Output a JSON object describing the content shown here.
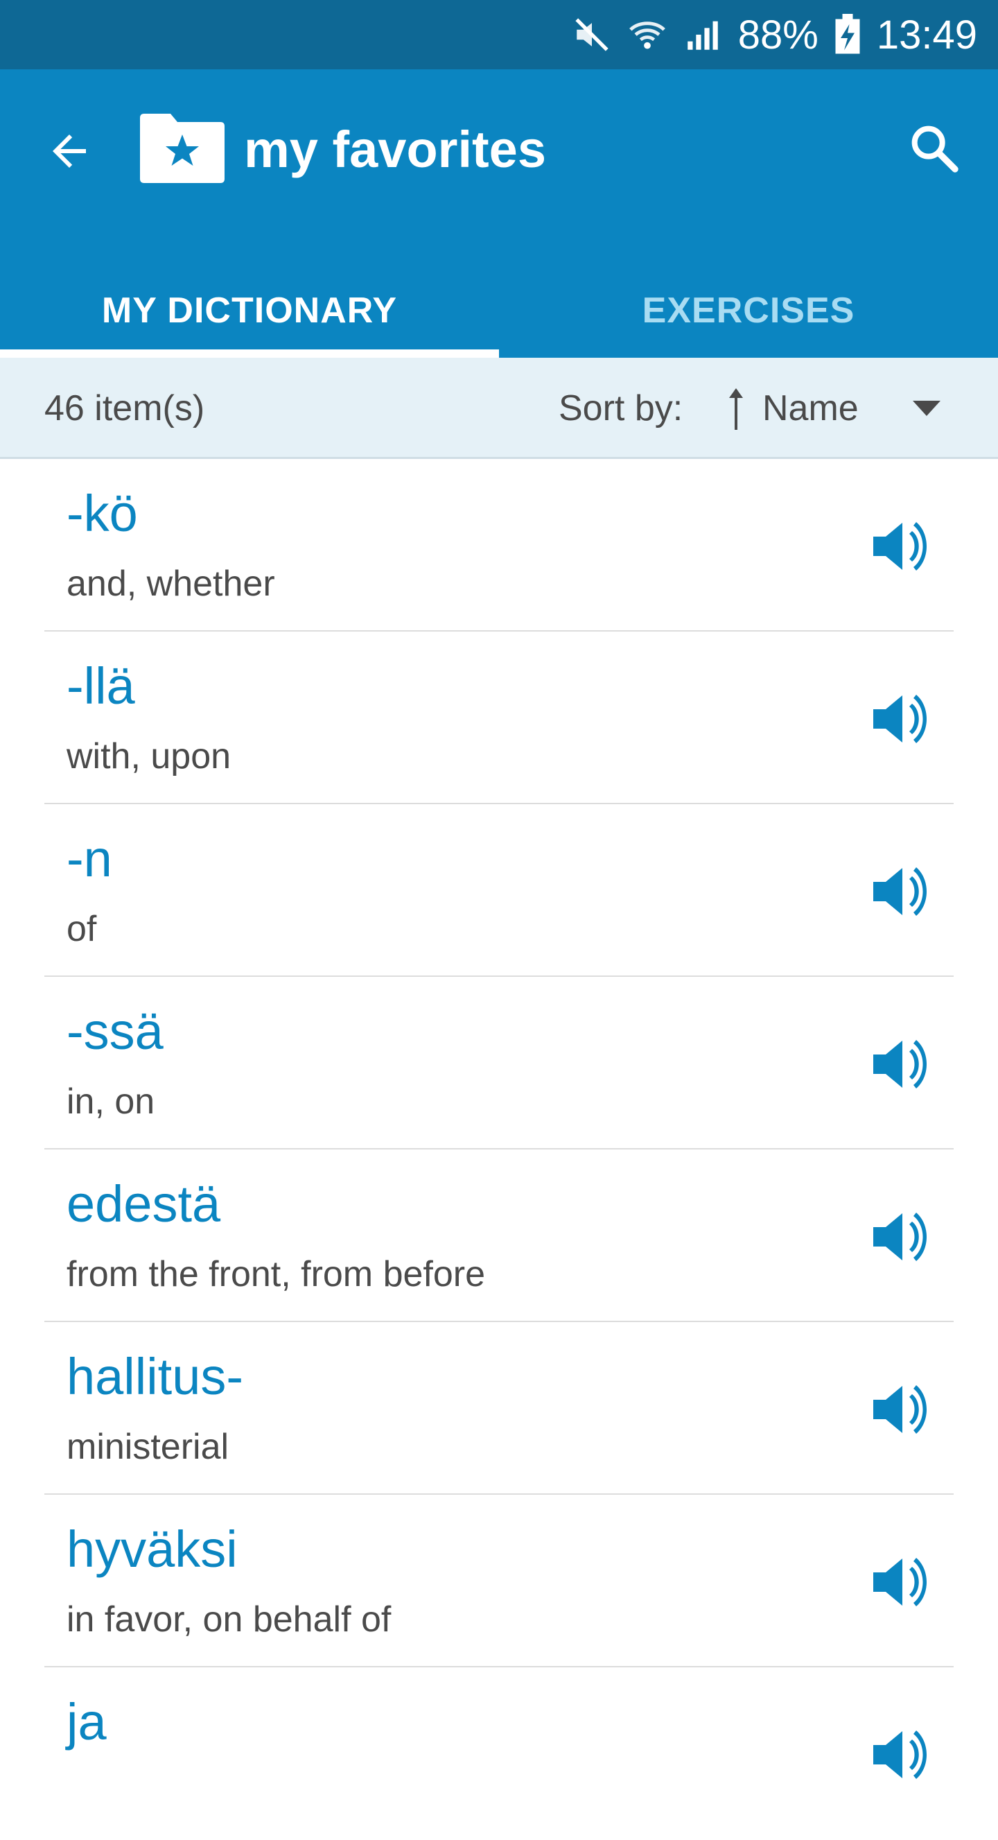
{
  "status_bar": {
    "battery_percent": "88%",
    "time": "13:49",
    "icons": [
      "mute-icon",
      "wifi-icon",
      "signal-icon",
      "battery-charging-icon"
    ]
  },
  "app_bar": {
    "title": "my favorites",
    "icons": [
      "back-arrow-icon",
      "folder-star-icon",
      "search-icon"
    ],
    "tabs": [
      {
        "label": "MY DICTIONARY",
        "selected": true
      },
      {
        "label": "EXERCISES",
        "selected": false
      }
    ]
  },
  "toolbar": {
    "item_count": "46 item(s)",
    "sort_label": "Sort by:",
    "sort_value": "Name",
    "sort_direction_icon": "sort-ascending-icon",
    "dropdown_icon": "dropdown-triangle-icon"
  },
  "items": [
    {
      "term": "-kö",
      "meaning": "and, whether"
    },
    {
      "term": "-llä",
      "meaning": "with, upon"
    },
    {
      "term": "-n",
      "meaning": "of"
    },
    {
      "term": "-ssä",
      "meaning": "in, on"
    },
    {
      "term": "edestä",
      "meaning": "from the front, from before"
    },
    {
      "term": "hallitus-",
      "meaning": "ministerial"
    },
    {
      "term": "hyväksi",
      "meaning": "in favor, on behalf of"
    },
    {
      "term": "ja",
      "meaning": ""
    }
  ],
  "colors": {
    "status_bar": "#0e6895",
    "app_bar": "#0b85c1",
    "toolbar_bg": "#e5f1f7",
    "term_text": "#0b85c1",
    "meaning_text": "#4a4a4a",
    "inactive_tab": "#a9dcf2"
  }
}
